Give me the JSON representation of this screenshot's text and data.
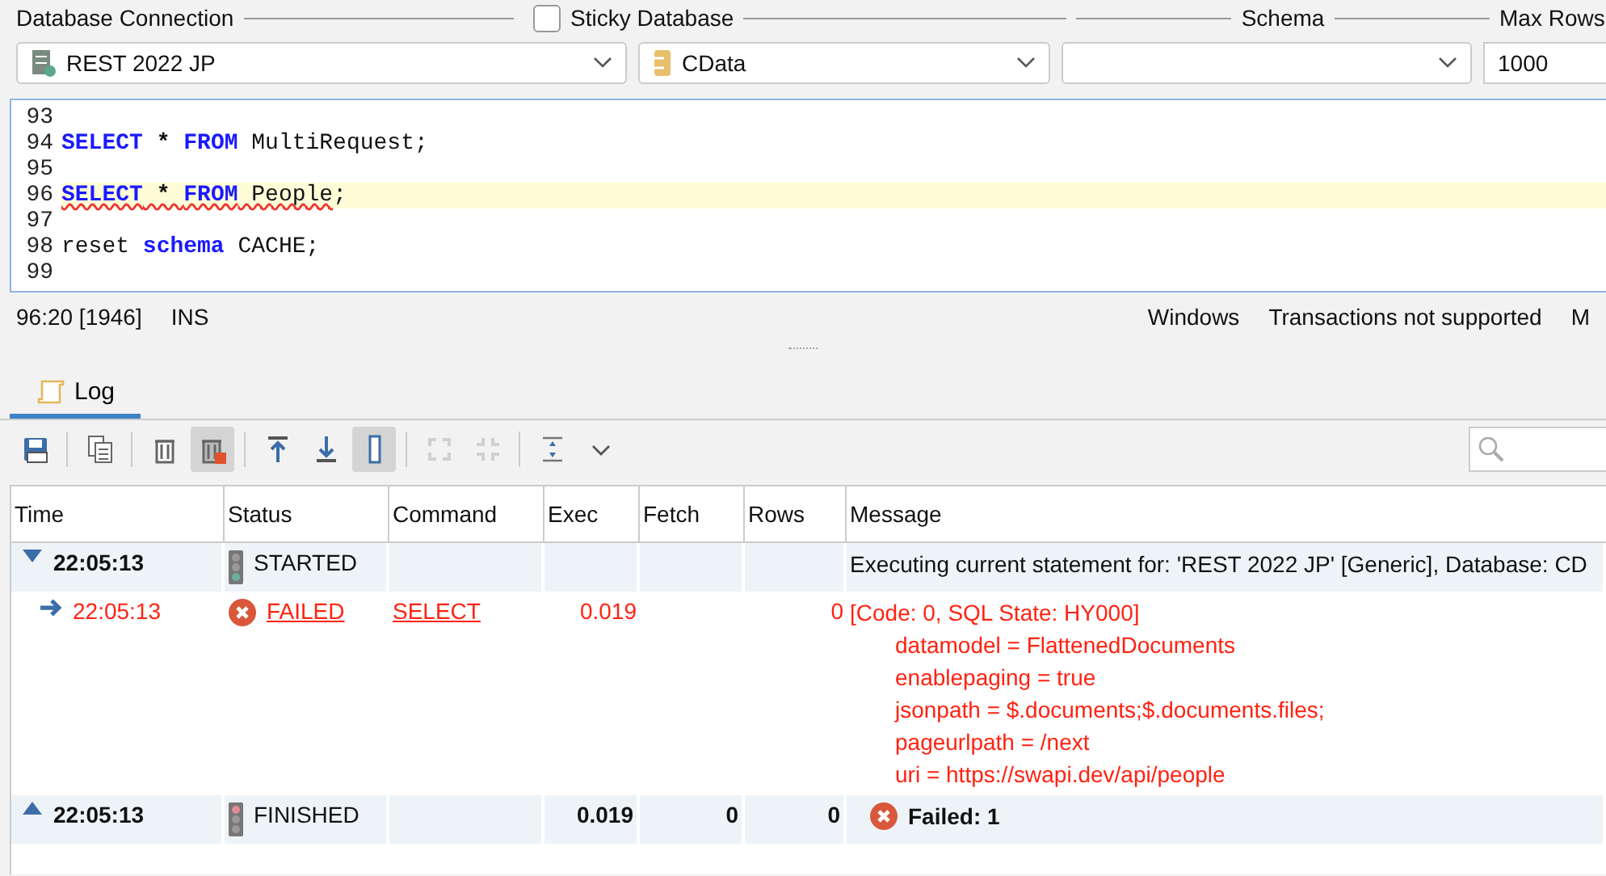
{
  "connection": {
    "label": "Database Connection",
    "value": "REST 2022 JP"
  },
  "sticky_database": {
    "label": "Sticky Database",
    "checked": false
  },
  "database": {
    "value": "CData"
  },
  "schema": {
    "label": "Schema"
  },
  "max_rows": {
    "label": "Max Rows",
    "value": "1000"
  },
  "editor": {
    "lines": [
      {
        "number": "93",
        "current": false
      },
      {
        "number": "94",
        "current": false,
        "tokens": [
          {
            "text": "SELECT",
            "kind": "keyword",
            "error": false
          },
          {
            "text": " * ",
            "kind": "operator",
            "error": false
          },
          {
            "text": "FROM",
            "kind": "keyword",
            "error": false
          },
          {
            "text": " MultiRequest;",
            "kind": "text",
            "error": false
          }
        ]
      },
      {
        "number": "95",
        "current": false
      },
      {
        "number": "96",
        "current": true,
        "tokens": [
          {
            "text": "SELECT",
            "kind": "keyword",
            "error": true
          },
          {
            "text": " * ",
            "kind": "operator",
            "error": true
          },
          {
            "text": "FROM",
            "kind": "keyword",
            "error": true
          },
          {
            "text": " People",
            "kind": "text",
            "error": true
          },
          {
            "text": ";",
            "kind": "text",
            "error": false
          }
        ]
      },
      {
        "number": "97",
        "current": false
      },
      {
        "number": "98",
        "current": false,
        "tokens": [
          {
            "text": "reset ",
            "kind": "text",
            "error": false
          },
          {
            "text": "schema",
            "kind": "keyword",
            "error": false
          },
          {
            "text": " CACHE;",
            "kind": "text",
            "error": false
          }
        ]
      },
      {
        "number": "99",
        "current": false
      }
    ]
  },
  "status_bar": {
    "left": [
      "96:20 [1946]",
      "INS"
    ],
    "right": [
      "Windows",
      "Transactions not supported",
      "M"
    ]
  },
  "tabs": [
    {
      "label": "Log",
      "selected": true
    }
  ],
  "toolbar": [
    {
      "pressed": false,
      "disabled": false
    },
    {
      "pressed": false,
      "disabled": false
    },
    {
      "pressed": false,
      "disabled": false
    },
    {
      "pressed": true,
      "disabled": false
    },
    {
      "pressed": false,
      "disabled": false
    },
    {
      "pressed": false,
      "disabled": false
    },
    {
      "pressed": true,
      "disabled": false
    },
    {
      "pressed": false,
      "disabled": true
    },
    {
      "pressed": false,
      "disabled": true
    },
    {
      "pressed": false,
      "disabled": false
    },
    {
      "pressed": false,
      "disabled": false
    }
  ],
  "log_table": {
    "columns": [
      "Time",
      "Status",
      "Command",
      "Exec",
      "Fetch",
      "Rows",
      "Message"
    ],
    "rows": [
      {
        "kind": "start",
        "expanded": true,
        "error": false,
        "time": "22:05:13",
        "status": "STARTED",
        "message": "Executing current statement for: 'REST 2022 JP' [Generic], Database: CD",
        "children": [
          {
            "kind": "statement",
            "expanded": false,
            "error": true,
            "time": "22:05:13",
            "status": "FAILED",
            "command": "SELECT",
            "exec": "0.019",
            "rows": "0",
            "message": "[Code: 0, SQL State: HY000]",
            "details": [
              "datamodel = FlattenedDocuments",
              "enablepaging = true",
              "jsonpath = $.documents;$.documents.files;",
              "pageurlpath = /next",
              "uri = https://swapi.dev/api/people"
            ]
          }
        ]
      },
      {
        "kind": "end",
        "expanded": false,
        "error": false,
        "time": "22:05:13",
        "status": "FINISHED",
        "exec": "0.019",
        "fetch": "0",
        "rows": "0",
        "message": "Failed: 1"
      }
    ]
  }
}
